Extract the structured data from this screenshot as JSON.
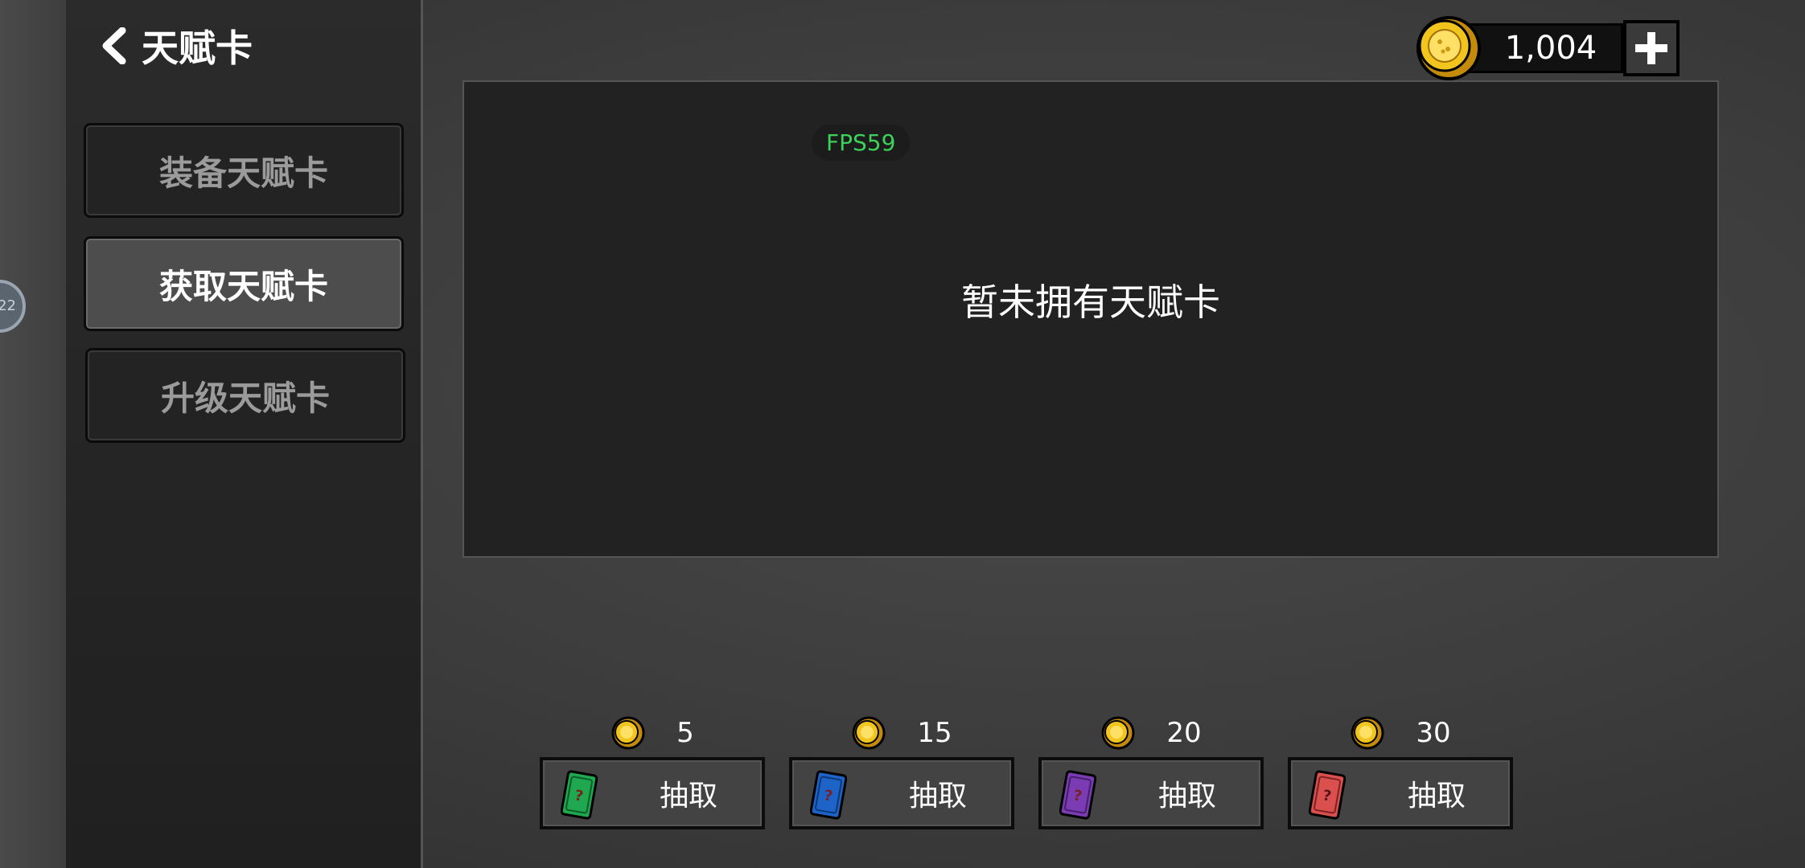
{
  "header": {
    "title": "天赋卡"
  },
  "side_badge": {
    "text": "22"
  },
  "menu": {
    "items": [
      {
        "label": "装备天赋卡",
        "active": false
      },
      {
        "label": "获取天赋卡",
        "active": true
      },
      {
        "label": "升级天赋卡",
        "active": false
      }
    ]
  },
  "currency": {
    "amount": "1,004"
  },
  "panel": {
    "fps": "FPS59",
    "empty_message": "暂未拥有天赋卡"
  },
  "draws": [
    {
      "cost": "5",
      "label": "抽取",
      "card_color": "#1fa84f"
    },
    {
      "cost": "15",
      "label": "抽取",
      "card_color": "#1e63c8"
    },
    {
      "cost": "20",
      "label": "抽取",
      "card_color": "#7b3bb3"
    },
    {
      "cost": "30",
      "label": "抽取",
      "card_color": "#d9504f"
    }
  ],
  "colors": {
    "coin": "#e8b91c",
    "fps_text": "#3dd15a"
  },
  "icons": [
    "back-chevron-icon",
    "coin-icon",
    "plus-icon",
    "mystery-card-icon"
  ]
}
